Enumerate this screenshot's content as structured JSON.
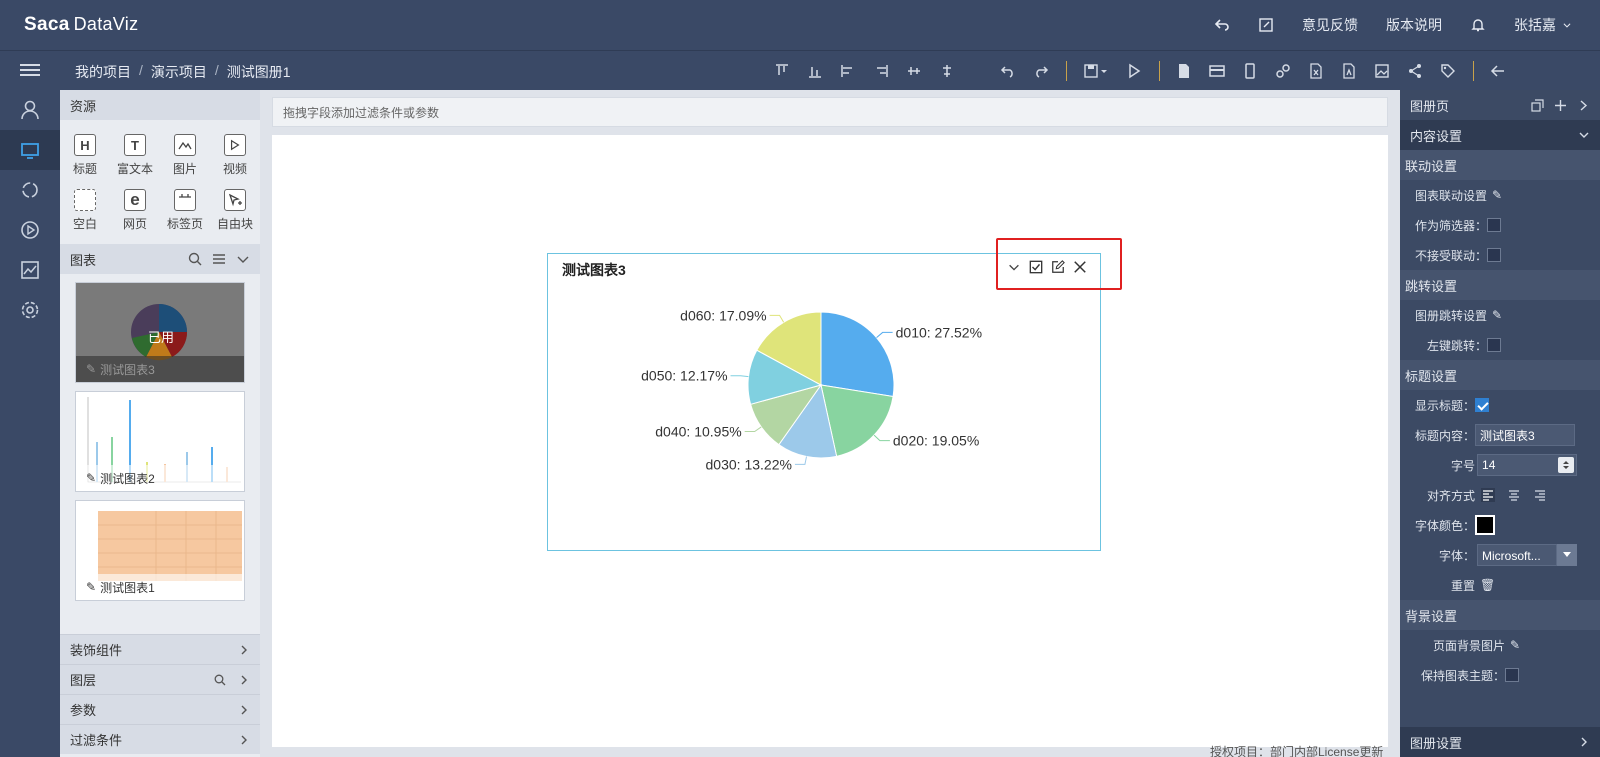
{
  "app": {
    "logo_main": "Sa",
    "logo_mark": "ca",
    "logo_name": "DataViz",
    "user": "张括嘉",
    "feedback": "意见反馈",
    "version": "版本说明"
  },
  "breadcrumb": [
    "我的项目",
    "演示项目",
    "测试图册1"
  ],
  "resources": {
    "title": "资源",
    "items": [
      {
        "icon": "H",
        "label": "标题"
      },
      {
        "icon": "T",
        "label": "富文本"
      },
      {
        "icon": "image-icon",
        "label": "图片"
      },
      {
        "icon": "play-icon",
        "label": "视频"
      },
      {
        "icon": "blank-icon",
        "label": "空白"
      },
      {
        "icon": "e",
        "label": "网页"
      },
      {
        "icon": "tab-icon",
        "label": "标签页"
      },
      {
        "icon": "free-block-icon",
        "label": "自由块"
      }
    ],
    "charts_title": "图表",
    "thumbs": [
      {
        "label": "测试图表3",
        "used": "已用"
      },
      {
        "label": "测试图表2"
      },
      {
        "label": "测试图表1"
      }
    ],
    "accordions": [
      "装饰组件",
      "图层",
      "参数",
      "过滤条件"
    ]
  },
  "canvas": {
    "filter_placeholder": "拖拽字段添加过滤条件或参数",
    "license": "授权项目：部门内部License更新"
  },
  "chart": {
    "title": "测试图表3"
  },
  "chart_data": {
    "type": "pie",
    "title": "测试图表3",
    "categories": [
      "d010",
      "d020",
      "d030",
      "d040",
      "d050",
      "d060"
    ],
    "values": [
      27.52,
      19.05,
      13.22,
      10.95,
      12.17,
      17.09
    ],
    "labels": [
      "d010: 27.52%",
      "d020: 19.05%",
      "d030: 13.22%",
      "d040: 10.95%",
      "d050: 12.17%",
      "d060: 17.09%"
    ],
    "colors": [
      "#55acee",
      "#88d4a0",
      "#9cc9ea",
      "#b3d6a3",
      "#80d0e0",
      "#dfe47a"
    ]
  },
  "rpanel": {
    "title": "图册页",
    "content_settings": "内容设置",
    "linkage": "联动设置",
    "chart_linkage": "图表联动设置",
    "as_filter": "作为筛选器：",
    "no_linkage": "不接受联动：",
    "jump": "跳转设置",
    "book_jump": "图册跳转设置",
    "left_jump": "左键跳转：",
    "title_settings": "标题设置",
    "show_title": "显示标题：",
    "title_content_label": "标题内容：",
    "title_content": "测试图表3",
    "font_size_label": "字号",
    "font_size": "14",
    "align_label": "对齐方式",
    "font_color_label": "字体颜色：",
    "font_label": "字体：",
    "font_value": "Microsoft...",
    "reset": "重置",
    "bg_settings": "背景设置",
    "page_bg": "页面背景图片",
    "keep_theme": "保持图表主题：",
    "book_settings": "图册设置"
  }
}
